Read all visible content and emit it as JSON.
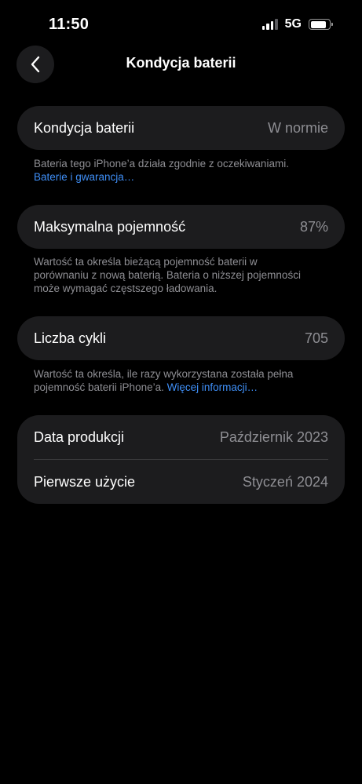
{
  "status_bar": {
    "time": "11:50",
    "network": "5G",
    "signal_bars_active": 3,
    "battery_level": 0.9
  },
  "nav": {
    "back_icon": "chevron-left-icon",
    "title": "Kondycja baterii"
  },
  "battery_health": {
    "label": "Kondycja baterii",
    "value": "W normie",
    "footnote_text": "Bateria tego iPhone’a działa zgodnie z oczekiwaniami.",
    "footnote_link": "Baterie i gwarancja…"
  },
  "max_capacity": {
    "label": "Maksymalna pojemność",
    "value": "87%",
    "footnote_text": "Wartość ta określa bieżącą pojemność baterii w porównaniu z nową baterią. Bateria o niższej pojemności może wymagać częstszego ładowania."
  },
  "cycle_count": {
    "label": "Liczba cykli",
    "value": "705",
    "footnote_text": "Wartość ta określa, ile razy wykorzystana została pełna pojemność baterii iPhone’a.",
    "footnote_link": "Więcej informacji…"
  },
  "dates": {
    "manufacture_label": "Data produkcji",
    "manufacture_value": "Październik 2023",
    "first_use_label": "Pierwsze użycie",
    "first_use_value": "Styczeń 2024"
  },
  "colors": {
    "background": "#000000",
    "card": "#1c1c1e",
    "secondary_text": "#8e8e93",
    "link": "#3f8ff7"
  }
}
